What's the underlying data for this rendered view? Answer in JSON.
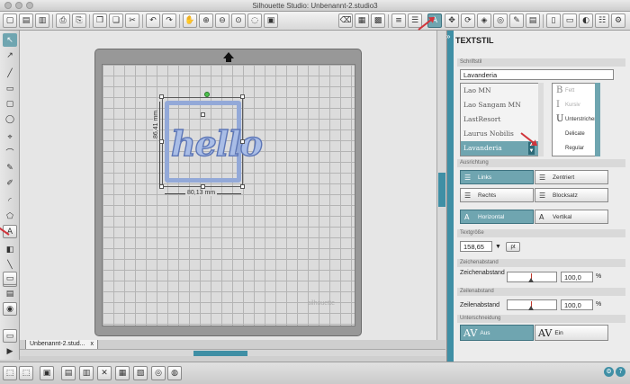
{
  "window": {
    "title": "Silhouette Studio: Unbenannt-2.studio3"
  },
  "toolbar": {
    "icons": [
      "new-icon",
      "open-icon",
      "save-icon",
      "print-icon",
      "print-cut-icon",
      "cut-icon",
      "copy-icon",
      "paste-icon",
      "scissors-icon",
      "undo-icon",
      "redo-icon",
      "pan-icon",
      "zoom-in-icon",
      "zoom-out-icon",
      "zoom-select-icon",
      "zoom-back-icon",
      "zoom-fit-icon",
      "eraser-icon",
      "page-setup-icon",
      "grid-icon",
      "fill-color-icon",
      "line-color-icon",
      "text-style-icon",
      "transform-icon",
      "replicate-icon",
      "modify-icon",
      "offset-icon",
      "trace-icon",
      "library-icon",
      "store-icon",
      "send-icon",
      "silhouette-icon",
      "connect-icon"
    ]
  },
  "document": {
    "tab_label": "Unbenannt-2.stud...",
    "tab_close": "x",
    "text_object": "hello",
    "width_label": "80,13 mm",
    "height_label": "86,41 mm",
    "watermark": "silhouette"
  },
  "panel": {
    "title": "TEXTSTIL",
    "font_section": "Schriftstil",
    "font_value": "Lavanderia",
    "fonts": [
      "Lao MN",
      "Lao Sangam MN",
      "LastResort",
      "Laurus Nobilis",
      "Lavanderia"
    ],
    "selected_font": "Lavanderia",
    "styles": [
      {
        "glyph": "B",
        "label": "Fett",
        "enabled": false
      },
      {
        "glyph": "I",
        "label": "Kursiv",
        "enabled": false
      },
      {
        "glyph": "U",
        "label": "Unterstrichen",
        "enabled": true
      },
      {
        "glyph": "",
        "label": "Delicate",
        "enabled": true
      },
      {
        "glyph": "",
        "label": "Regular",
        "enabled": true
      }
    ],
    "alignment_section": "Ausrichtung",
    "align_left": "Links",
    "align_center": "Zentriert",
    "align_right": "Rechts",
    "align_justify": "Blocksatz",
    "dir_horizontal": "Horizontal",
    "dir_vertical": "Vertikal",
    "size_section": "Textgröße",
    "size_value": "158,65",
    "size_unit": "pt",
    "char_spacing_section": "Zeichenabstand",
    "char_spacing_label": "Zeichenabstand",
    "char_spacing_value": "100,0",
    "line_spacing_section": "Zeilenabstand",
    "line_spacing_label": "Zeilenabstand",
    "line_spacing_value": "100,0",
    "percent": "%",
    "kerning_section": "Unterschneidung",
    "kerning_off": "Aus",
    "kerning_on": "Ein"
  }
}
